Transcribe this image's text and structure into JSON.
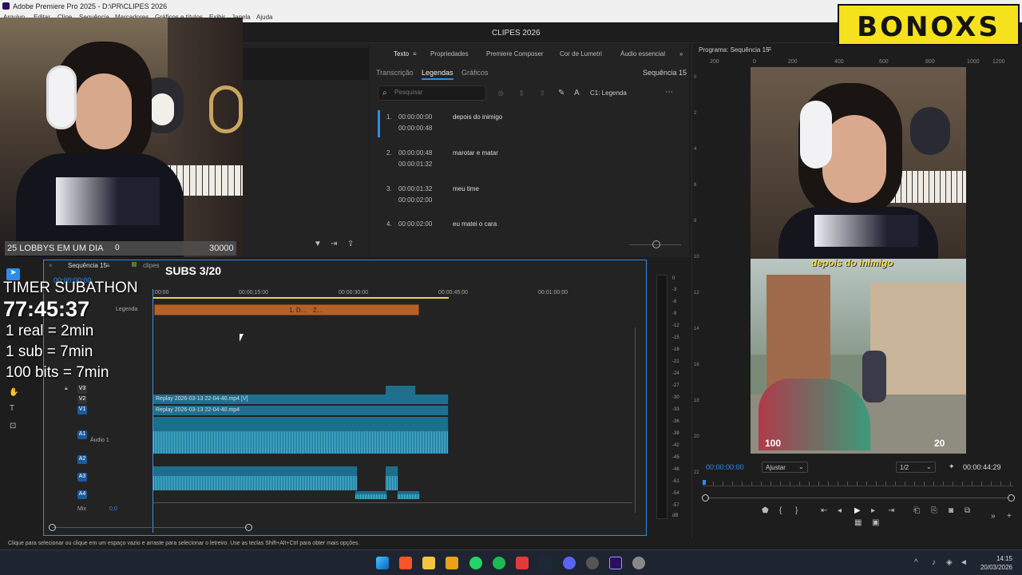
{
  "window": {
    "title": "Adobe Premiere Pro 2025 - D:\\PR\\CLIPES 2026",
    "project": "CLIPES 2026"
  },
  "menu": [
    "Arquivo",
    "Editar",
    "Clipe",
    "Sequência",
    "Marcadores",
    "Gráficos e títulos",
    "Exibir",
    "Janela",
    "Ajuda"
  ],
  "brand": {
    "logo": "BONOXS",
    "color": "#f6e21c"
  },
  "stream_overlay": {
    "goal_label": "25 LOBBYS EM UM DIA",
    "goal_count": "0",
    "goal_target": "30000",
    "subs": "SUBS 3/20",
    "timer_title": "TIMER SUBATHON",
    "timer_value": "77:45:37",
    "rule1": "1 real = 2min",
    "rule2": "1 sub =  7min",
    "rule3": "100 bits = 7min"
  },
  "text_panel": {
    "tabs": [
      "Texto",
      "Propriedades",
      "Premiere Composer",
      "Cor de Lumetri",
      "Áudio essencial"
    ],
    "subtabs": [
      "Transcrição",
      "Legendas",
      "Gráficos"
    ],
    "sequence": "Sequência 15",
    "search_placeholder": "Pesquisar",
    "caption_track": "C1: Legenda",
    "captions": [
      {
        "n": "1.",
        "in": "00:00:00:00",
        "out": "00:00:00:48",
        "text": "depois do inimigo"
      },
      {
        "n": "2.",
        "in": "00:00:00:48",
        "out": "00:00:01:32",
        "text": "marotar e matar"
      },
      {
        "n": "3.",
        "in": "00:00:01:32",
        "out": "00:00:02:00",
        "text": "meu time"
      },
      {
        "n": "4.",
        "in": "00:00:02:00",
        "out": "",
        "text": "eu matei o cara"
      }
    ]
  },
  "program": {
    "title": "Programa: Sequência 15",
    "ruler": [
      "200",
      "0",
      "200",
      "400",
      "600",
      "800",
      "1000",
      "1200"
    ],
    "vruler": [
      "0",
      "2",
      "4",
      "6",
      "8",
      "10",
      "12",
      "14",
      "16",
      "18",
      "20",
      "22"
    ],
    "timecode": "00:00:00:00",
    "fit": "Ajustar",
    "resolution": "1/2",
    "duration": "00:00:44:29",
    "caption": "depois do inimigo",
    "hp": "100",
    "ammo": "20"
  },
  "timeline": {
    "tab": "Sequência 15",
    "bin": "clipes",
    "timecode": "00:00:00:00",
    "ruler": [
      ":00:00",
      "00:00:15:00",
      "00:00:30:00",
      "00:00:45:00",
      "00:01:00:00"
    ],
    "caption_track": "Legenda",
    "caption_marks": [
      "1. D...",
      "2..."
    ],
    "video_clip": "Replay 2026-03-13 22-04-40.mp4 [V]",
    "video_clip2": "Replay 2026-03-13 22-04-40.mp4",
    "tracks": [
      "V3",
      "V2",
      "V1",
      "A1",
      "A2",
      "A3",
      "A4"
    ],
    "audio1_name": "Áudio 1",
    "mix": "Mix",
    "mix_val": "0,0"
  },
  "meters": [
    "0",
    "-3",
    "-6",
    "-9",
    "-12",
    "-15",
    "-18",
    "-21",
    "-24",
    "-27",
    "-30",
    "-33",
    "-36",
    "-39",
    "-42",
    "-45",
    "-48",
    "-51",
    "-54",
    "-57",
    "dB"
  ],
  "status": "Clique para selecionar ou clique em um espaço vazio e arraste para selecionar o letreiro. Use as teclas Shift+Alt+Ctrl para obter mais opções.",
  "clock": {
    "time": "14:15",
    "date": "20/03/2026"
  }
}
